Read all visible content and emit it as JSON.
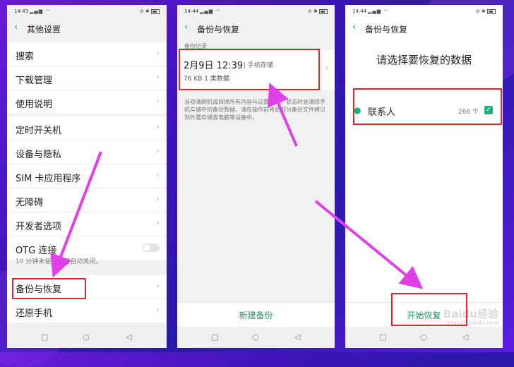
{
  "status": {
    "time": "14:43",
    "time2": "14:44",
    "time3": "14:44"
  },
  "screen1": {
    "title": "其他设置",
    "group1": [
      "搜索",
      "下载管理",
      "使用说明"
    ],
    "group2": [
      "定时开关机",
      "设备与隐私",
      "SIM 卡应用程序",
      "无障碍",
      "开发者选项",
      "OTG 连接"
    ],
    "otg_note": "10 分钟未使用，将自动关闭。",
    "group3": [
      "备份与恢复",
      "还原手机"
    ]
  },
  "screen2": {
    "title": "备份与恢复",
    "section": "备份记录",
    "record_date": "2月9日 12:39",
    "record_storage": "| 手机存储",
    "record_meta": "76 KB 1 类数据",
    "note": "当双清刷机或抹掉所有内容与设置到出厂状态时会清除手机存储中的备份数据，请在操作前将此部分备份文件拷贝到外置存储或电脑等设备中。",
    "new_backup": "新建备份"
  },
  "screen3": {
    "title": "备份与恢复",
    "heading": "请选择要恢复的数据",
    "contacts_label": "联系人",
    "contacts_count": "266 个",
    "start_restore": "开始恢复"
  },
  "watermark": {
    "brand": "Baidu经验",
    "url": "jingyan.baidu.com"
  },
  "colors": {
    "accent": "#1a9b6a",
    "highlight": "#e0262c",
    "arrow": "#e040e8"
  }
}
